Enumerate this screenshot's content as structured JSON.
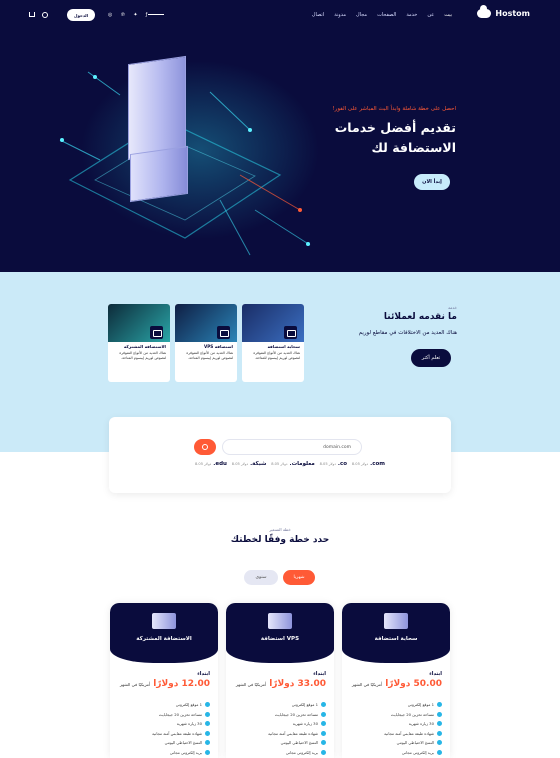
{
  "nav": {
    "brand": "Hostom",
    "menu": [
      "بيت",
      "عن",
      "خدمة",
      "الصفحات",
      "مجال",
      "مدونة",
      "اتصال"
    ],
    "login_label": "الدخول"
  },
  "hero": {
    "subtitle": "احصل على خطة شاملة وابدأ البث المباشر على الفور!",
    "title": "تقديم أفضل خدمات الاستضافة لك",
    "cta": "إبدأ الان"
  },
  "services": {
    "eyebrow": "خدمة",
    "title": "ما نقدمه لعملائنا",
    "description": "هناك العديد من الاختلافات في مقاطع لوريم",
    "cta": "تعلم أكثر",
    "cards": [
      {
        "title": "سحابة استضافة",
        "text": "هناك العديد من الأنواع المتوفرة لنصوص لوريم إيبسوم للمتاحة."
      },
      {
        "title": "استضافة VPS",
        "text": "هناك العديد من الأنواع المتوفرة لنصوص لوريم إيبسوم المتاحة."
      },
      {
        "title": "الاستضافة المشتركة",
        "text": "هناك العديد من الأنواع المتوفرة لنصوص لوريم إيبسوم المتاحة."
      }
    ]
  },
  "domain": {
    "placeholder": "domain.com",
    "tlds": [
      {
        "name": ".com",
        "price": "8.05 دولار"
      },
      {
        "name": ".co",
        "price": "8.05 دولار"
      },
      {
        "name": ".معلومات",
        "price": "8.05 دولار"
      },
      {
        "name": ".شبكة",
        "price": "8.05 دولار"
      },
      {
        "name": ".edu",
        "price": "8.05 دولار"
      }
    ]
  },
  "plans": {
    "eyebrow": "خطة التسعير",
    "title": "حدد خطة وفقًا لخطتك",
    "monthly": "شهريا",
    "yearly": "سنوي",
    "items": [
      {
        "name": "سحابة استضافة",
        "from": "ابتداء",
        "price": "50.00 دولارًا",
        "period": "أمريكيًا في الشهر",
        "features": [
          "1 موقع إلكتروني",
          "مساحة تخزين 20 جيجابايت",
          "30 زيارة شهرية",
          "شهادة طبقة مقابس آمنة مجانية",
          "النسخ الاحتياطي اليومي",
          "بريد إلكتروني مجاني"
        ]
      },
      {
        "name": "استضافة VPS",
        "from": "ابتداء",
        "price": "33.00 دولارًا",
        "period": "أمريكيًا في الشهر",
        "features": [
          "1 موقع إلكتروني",
          "مساحة تخزين 20 جيجابايت",
          "30 زيارة شهرية",
          "شهادة طبقة مقابس آمنة مجانية",
          "النسخ الاحتياطي اليومي",
          "بريد إلكتروني مجاني"
        ]
      },
      {
        "name": "الاستضافة المشتركة",
        "from": "ابتداء",
        "price": "12.00 دولارًا",
        "period": "أمريكيًا في الشهر",
        "features": [
          "1 موقع إلكتروني",
          "مساحة تخزين 20 جيجابايت",
          "30 زيارة شهرية",
          "شهادة طبقة مقابس آمنة مجانية",
          "النسخ الاحتياطي اليومي",
          "بريد إلكتروني مجاني"
        ]
      }
    ]
  }
}
